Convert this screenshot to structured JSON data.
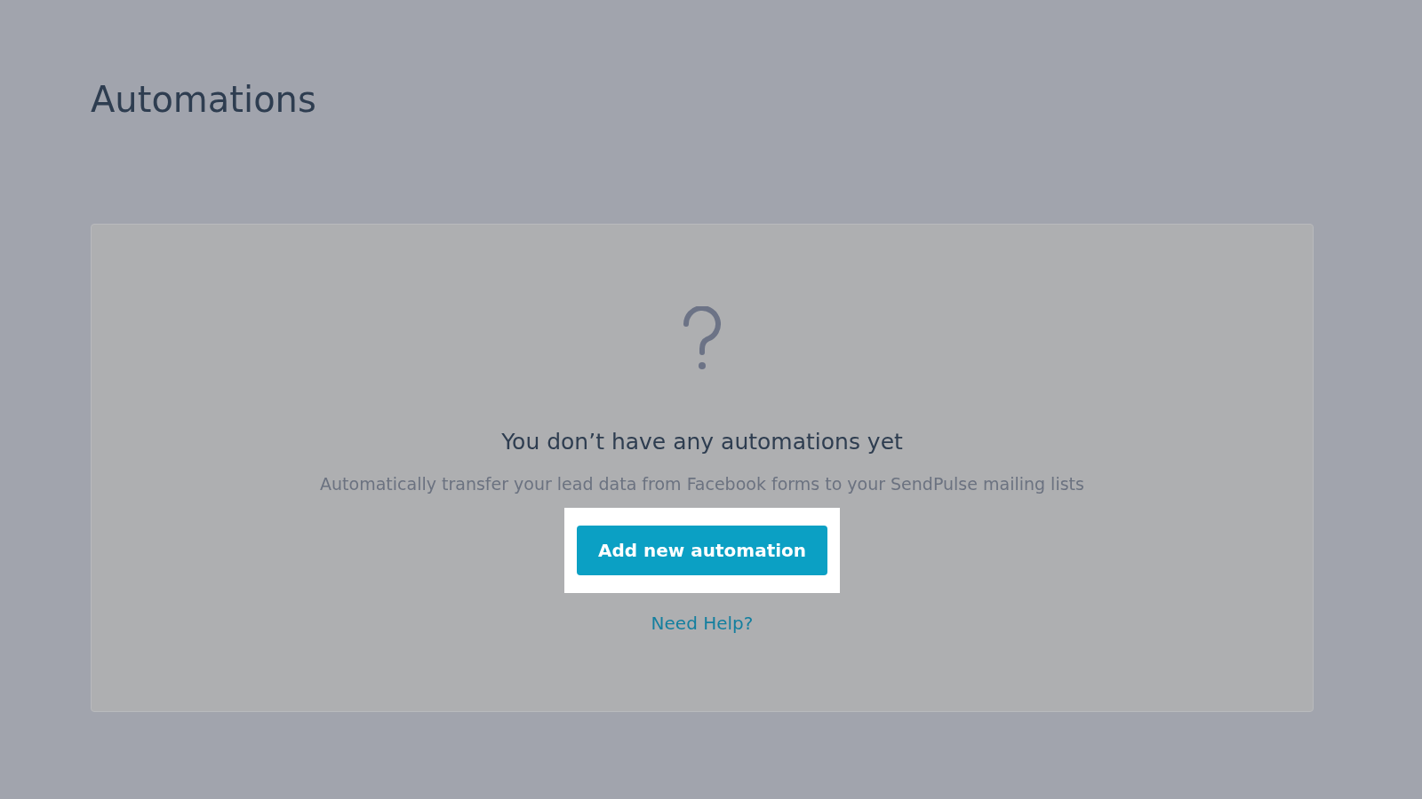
{
  "page": {
    "title": "Automations"
  },
  "empty_state": {
    "heading": "You don’t have any automations yet",
    "description": "Automatically transfer your lead data from Facebook forms to your SendPulse mailing lists",
    "button": "Add new automation",
    "button_highlighted": true,
    "help_link": "Need Help?"
  }
}
